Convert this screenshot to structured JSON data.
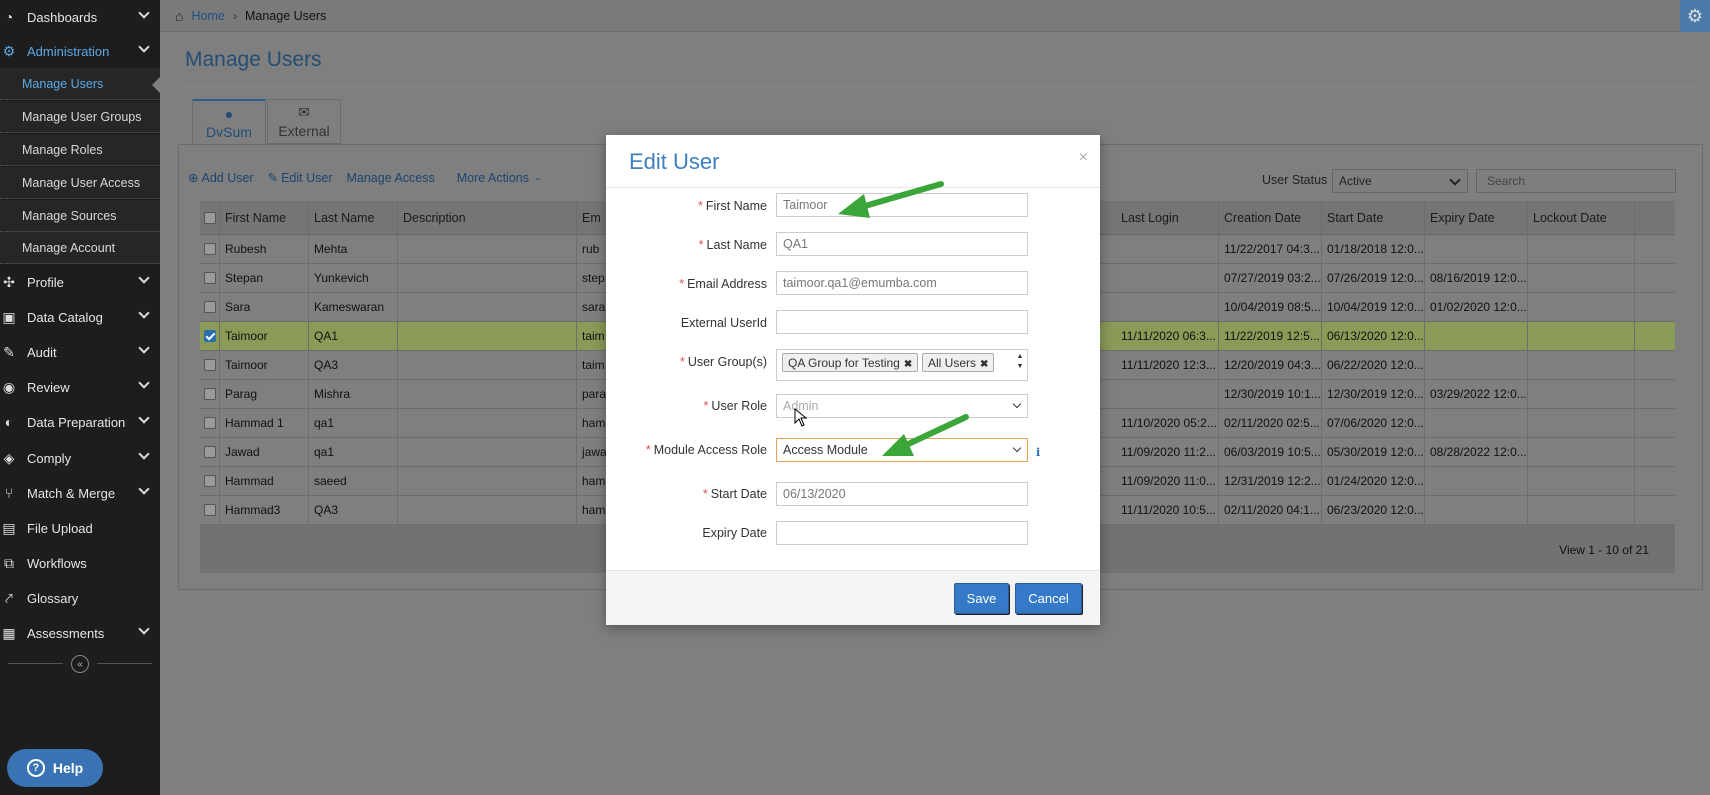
{
  "sidebar": {
    "items": [
      {
        "label": "Dashboards",
        "icon": "dashboard-icon"
      },
      {
        "label": "Administration",
        "icon": "cogs-icon"
      },
      {
        "label": "Profile",
        "icon": "profile-icon"
      },
      {
        "label": "Data Catalog",
        "icon": "catalog-icon"
      },
      {
        "label": "Audit",
        "icon": "audit-icon"
      },
      {
        "label": "Review",
        "icon": "review-icon"
      },
      {
        "label": "Data Preparation",
        "icon": "preparation-icon"
      },
      {
        "label": "Comply",
        "icon": "tag-icon"
      },
      {
        "label": "Match & Merge",
        "icon": "merge-icon"
      },
      {
        "label": "File Upload",
        "icon": "file-icon"
      },
      {
        "label": "Workflows",
        "icon": "workflow-icon"
      },
      {
        "label": "Glossary",
        "icon": "glossary-icon"
      },
      {
        "label": "Assessments",
        "icon": "assessment-icon"
      }
    ],
    "admin_sub": [
      "Manage Users",
      "Manage User Groups",
      "Manage Roles",
      "Manage User Access",
      "Manage Sources",
      "Manage Account"
    ],
    "help_label": "Help"
  },
  "breadcrumb": {
    "home": "Home",
    "current": "Manage Users"
  },
  "page_title": "Manage Users",
  "tabs": [
    {
      "label": "DvSum"
    },
    {
      "label": "External"
    }
  ],
  "actions": {
    "add": "Add User",
    "edit": "Edit User",
    "access": "Manage Access",
    "more": "More Actions"
  },
  "filter": {
    "status_label": "User Status",
    "status_value": "Active",
    "search_placeholder": "Search"
  },
  "table": {
    "columns": [
      "First Name",
      "Last Name",
      "Description",
      "Em",
      "Last Login",
      "Creation Date",
      "Start Date",
      "Expiry Date",
      "Lockout Date"
    ],
    "rows": [
      {
        "first": "Rubesh",
        "last": "Mehta",
        "desc": "",
        "email": "rub",
        "login": "",
        "created": "11/22/2017 04:3...",
        "start": "01/18/2018 12:0...",
        "expiry": "",
        "lockout": ""
      },
      {
        "first": "Stepan",
        "last": "Yunkevich",
        "desc": "",
        "email": "step",
        "login": "",
        "created": "07/27/2019 03:2...",
        "start": "07/26/2019 12:0...",
        "expiry": "08/16/2019 12:0...",
        "lockout": ""
      },
      {
        "first": "Sara",
        "last": "Kameswaran",
        "desc": "",
        "email": "sara",
        "login": "",
        "created": "10/04/2019 08:5...",
        "start": "10/04/2019 12:0...",
        "expiry": "01/02/2020 12:0...",
        "lockout": ""
      },
      {
        "first": "Taimoor",
        "last": "QA1",
        "desc": "",
        "email": "taim",
        "login": "11/11/2020 06:3...",
        "created": "11/22/2019 12:5...",
        "start": "06/13/2020 12:0...",
        "expiry": "",
        "lockout": ""
      },
      {
        "first": "Taimoor",
        "last": "QA3",
        "desc": "",
        "email": "taim",
        "login": "11/11/2020 12:3...",
        "created": "12/20/2019 04:3...",
        "start": "06/22/2020 12:0...",
        "expiry": "",
        "lockout": ""
      },
      {
        "first": "Parag",
        "last": "Mishra",
        "desc": "",
        "email": "para",
        "login": "",
        "created": "12/30/2019 10:1...",
        "start": "12/30/2019 12:0...",
        "expiry": "03/29/2022 12:0...",
        "lockout": ""
      },
      {
        "first": "Hammad 1",
        "last": "qa1",
        "desc": "",
        "email": "ham",
        "login": "11/10/2020 05:2...",
        "created": "02/11/2020 02:5...",
        "start": "07/06/2020 12:0...",
        "expiry": "",
        "lockout": ""
      },
      {
        "first": "Jawad",
        "last": "qa1",
        "desc": "",
        "email": "jawa",
        "login": "11/09/2020 11:2...",
        "created": "06/03/2019 10:5...",
        "start": "05/30/2019 12:0...",
        "expiry": "08/28/2022 12:0...",
        "lockout": ""
      },
      {
        "first": "Hammad",
        "last": "saeed",
        "desc": "",
        "email": "ham",
        "login": "11/09/2020 11:0...",
        "created": "12/31/2019 12:2...",
        "start": "01/24/2020 12:0...",
        "expiry": "",
        "lockout": ""
      },
      {
        "first": "Hammad3",
        "last": "QA3",
        "desc": "",
        "email": "ham",
        "login": "11/11/2020 10:5...",
        "created": "02/11/2020 04:1...",
        "start": "06/23/2020 12:0...",
        "expiry": "",
        "lockout": ""
      }
    ],
    "pager": "View 1 - 10 of 21"
  },
  "modal": {
    "title": "Edit User",
    "close": "×",
    "labels": {
      "first": "First Name",
      "last": "Last Name",
      "email": "Email Address",
      "external": "External UserId",
      "groups": "User Group(s)",
      "role": "User Role",
      "module": "Module Access Role",
      "start": "Start Date",
      "expiry": "Expiry Date"
    },
    "values": {
      "first": "Taimoor",
      "last": "QA1",
      "email": "taimoor.qa1@emumba.com",
      "external": "",
      "role": "Admin",
      "module": "Access Module",
      "start": "06/13/2020",
      "expiry": ""
    },
    "groups": [
      "QA Group for Testing",
      "All Users"
    ],
    "save": "Save",
    "cancel": "Cancel",
    "required_mark": "*",
    "info_mark": "i"
  },
  "colors": {
    "accent": "#3e7fbf",
    "sidebar": "#1d1d1d",
    "selected_row": "#8a9b58",
    "arrow": "#3aa63a"
  }
}
